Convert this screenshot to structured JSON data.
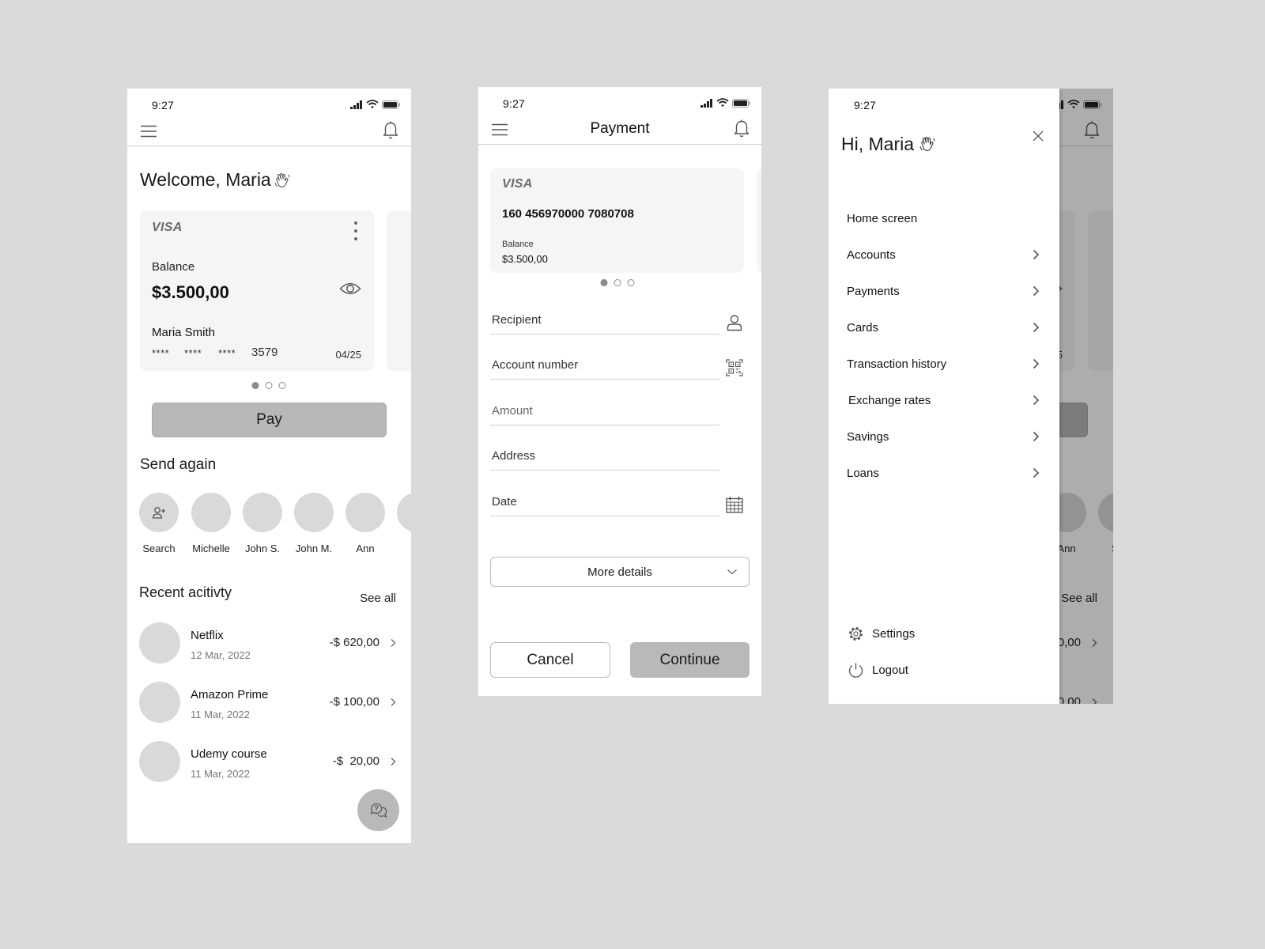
{
  "status_bar": {
    "time": "9:27"
  },
  "colors": {
    "background": "#dadada",
    "card": "#f5f5f5",
    "button_fill": "#b7b7b7",
    "avatar": "#d9d9d9"
  },
  "home": {
    "welcome": "Welcome, Maria",
    "card": {
      "brand": "VISA",
      "balance_label": "Balance",
      "balance": "$3.500,00",
      "holder": "Maria Smith",
      "masked": [
        "****",
        "****",
        "****"
      ],
      "last4": "3579",
      "expiry": "04/25"
    },
    "carousel": {
      "total": 3,
      "active_index": 0
    },
    "pay_label": "Pay",
    "send_again": {
      "title": "Send again",
      "contacts": [
        {
          "name": "Search",
          "icon": "person-add-icon"
        },
        {
          "name": "Michelle"
        },
        {
          "name": "John S."
        },
        {
          "name": "John M."
        },
        {
          "name": "Ann"
        },
        {
          "name": "Sa"
        }
      ]
    },
    "recent": {
      "title": "Recent acitivty",
      "see_all": "See all",
      "items": [
        {
          "title": "Netflix",
          "date": "12 Mar, 2022",
          "amount": "-$ 620,00"
        },
        {
          "title": "Amazon Prime",
          "date": "11 Mar, 2022",
          "amount": "-$ 100,00"
        },
        {
          "title": "Udemy course",
          "date": "11 Mar, 2022",
          "amount": "-$  20,00"
        }
      ]
    },
    "fab_icon": "chat-help-icon"
  },
  "payment": {
    "title": "Payment",
    "card": {
      "brand": "VISA",
      "number": "160 456970000 7080708",
      "balance_label": "Balance",
      "balance": "$3.500,00"
    },
    "carousel": {
      "total": 3,
      "active_index": 0
    },
    "fields": [
      {
        "label": "Recipient",
        "icon": "person-icon"
      },
      {
        "label": "Account number",
        "icon": "qr-code-icon"
      },
      {
        "label": "Amount"
      },
      {
        "label": "Address"
      },
      {
        "label": "Date",
        "icon": "calendar-icon"
      }
    ],
    "more_details": "More details",
    "cancel": "Cancel",
    "continue": "Continue"
  },
  "menu": {
    "greeting": "Hi, Maria",
    "items": [
      {
        "label": "Home screen",
        "chevron": false
      },
      {
        "label": "Accounts",
        "chevron": true
      },
      {
        "label": "Payments",
        "chevron": true
      },
      {
        "label": "Cards",
        "chevron": true
      },
      {
        "label": "Transaction history",
        "chevron": true
      },
      {
        "label": "Exchange rates",
        "chevron": true
      },
      {
        "label": "Savings",
        "chevron": true
      },
      {
        "label": "Loans",
        "chevron": true
      }
    ],
    "footer": [
      {
        "label": "Settings",
        "icon": "gear-icon"
      },
      {
        "label": "Logout",
        "icon": "power-icon"
      }
    ]
  }
}
